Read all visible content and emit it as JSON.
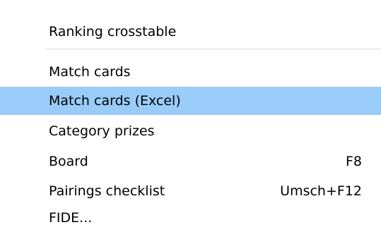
{
  "menu": {
    "items": [
      {
        "label": "Ranking crosstable",
        "shortcut": ""
      },
      {
        "label": "Match cards",
        "shortcut": ""
      },
      {
        "label": "Match cards (Excel)",
        "shortcut": "",
        "highlighted": true
      },
      {
        "label": "Category prizes",
        "shortcut": ""
      },
      {
        "label": "Board",
        "shortcut": "F8"
      },
      {
        "label": "Pairings checklist",
        "shortcut": "Umsch+F12"
      },
      {
        "label": "FIDE...",
        "shortcut": ""
      }
    ]
  },
  "colors": {
    "highlight": "#99ccf9",
    "separator": "#d7d7d7",
    "background": "#ffffff",
    "text": "#000000"
  }
}
